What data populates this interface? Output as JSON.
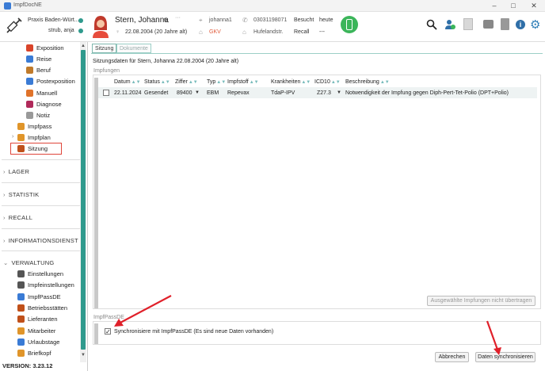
{
  "window": {
    "title": "ImpfDocNE",
    "controls": [
      "–",
      "□",
      "✕"
    ]
  },
  "header": {
    "practice": "Praxis Baden-Würt...",
    "user": "strub, anja",
    "patient_name": "Stern, Johanna",
    "dob": "22.08.2004",
    "age": "(20 Jahre alt)",
    "login": "johanna1",
    "insurance": "GKV",
    "phone": "03031198071",
    "street": "Hufelandstr.",
    "visited_label": "Besucht",
    "visited_value": "heute",
    "recall_label": "Recall",
    "recall_value": "---",
    "dots": "···"
  },
  "sidebar": {
    "items": [
      {
        "label": "Exposition",
        "color": "#d9442a"
      },
      {
        "label": "Reise",
        "color": "#3a7bd5"
      },
      {
        "label": "Beruf",
        "color": "#c07a2a"
      },
      {
        "label": "Postexposition",
        "color": "#3a7bd5"
      },
      {
        "label": "Manuell",
        "color": "#e0732a"
      },
      {
        "label": "Diagnose",
        "color": "#b02a5a"
      },
      {
        "label": "Notiz",
        "color": "#999999"
      },
      {
        "label": "Impfpass",
        "color": "#e0952a"
      },
      {
        "label": "Impfplan",
        "color": "#e0952a"
      },
      {
        "label": "Sitzung",
        "color": "#c0501a"
      }
    ],
    "sections": [
      "LAGER",
      "STATISTIK",
      "RECALL",
      "INFORMATIONSDIENST",
      "VERWALTUNG"
    ],
    "admin_items": [
      {
        "label": "Einstellungen",
        "color": "#555555"
      },
      {
        "label": "Impfeinstellungen",
        "color": "#555555"
      },
      {
        "label": "ImpfPassDE",
        "color": "#3a7bd5"
      },
      {
        "label": "Betriebsstätten",
        "color": "#c0501a"
      },
      {
        "label": "Lieferanten",
        "color": "#c0501a"
      },
      {
        "label": "Mitarbeiter",
        "color": "#e0952a"
      },
      {
        "label": "Urlaubstage",
        "color": "#3a7bd5"
      },
      {
        "label": "Briefkopf",
        "color": "#e0952a"
      }
    ],
    "version": "VERSION: 3.23.12"
  },
  "main": {
    "tabs": [
      "Sitzung",
      "Dokumente"
    ],
    "title": "Sitzungsdaten für Stern, Johanna 22.08.2004 (20 Jahre alt)",
    "vaccinations_group": "Impfungen",
    "columns": [
      "Datum",
      "Status",
      "Ziffer",
      "Typ",
      "Impfstoff",
      "Krankheiten",
      "ICD10",
      "Beschreibung"
    ],
    "rows": [
      {
        "datum": "22.11.2024",
        "status": "Gesendet",
        "ziffer": "89400",
        "typ": "EBM",
        "impfstoff": "Repevax",
        "krankheiten": "TdaP-IPV",
        "icd10": "Z27.3",
        "beschreibung": "Notwendigkeit der Impfung gegen Diph-Pert-Tet-Polio (DPT+Polio)"
      }
    ],
    "transfer_button": "Ausgewählte Impfungen nicht übertragen",
    "impfpass_group": "ImpfPassDE",
    "sync_checkbox_label": "Synchronisiere mit ImpfPassDE (Es sind neue Daten vorhanden)",
    "sync_checked": true,
    "cancel_button": "Abbrechen",
    "sync_button": "Daten synchronisieren"
  },
  "colors": {
    "accent": "#2f9a8d",
    "highlight_box": "#e0453a",
    "arrow": "#e0202a"
  }
}
